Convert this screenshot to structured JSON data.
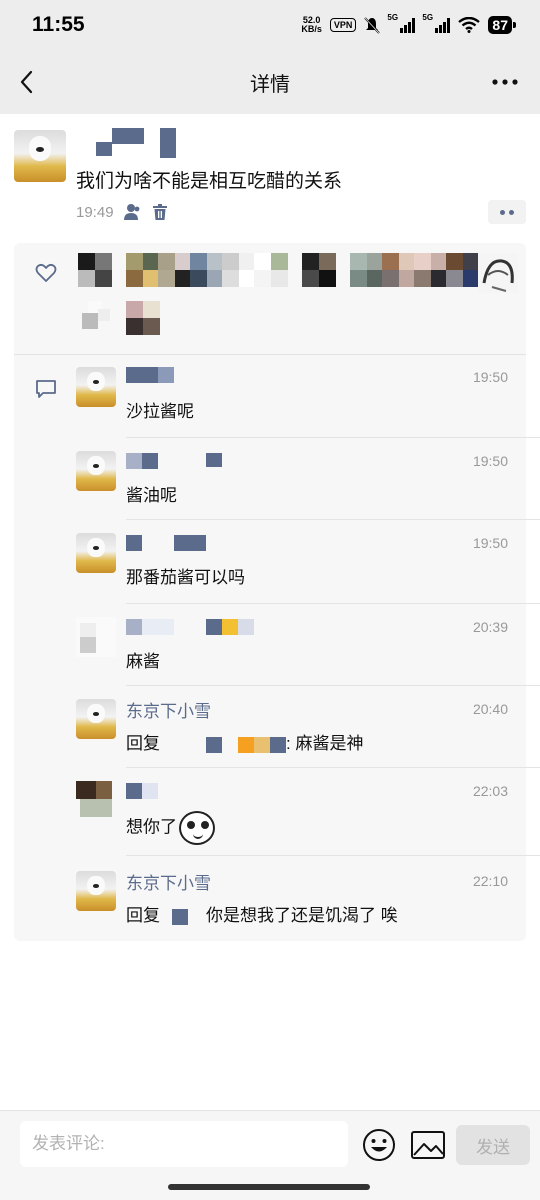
{
  "status_bar": {
    "time": "11:55",
    "net_speed_value": "52.0",
    "net_speed_unit": "KB/s",
    "vpn": "VPN",
    "sim1_label": "5G",
    "sim2_label": "5G",
    "battery": "87"
  },
  "nav": {
    "title": "详情",
    "back_icon": "chevron-left-icon",
    "more_icon": "more-horizontal-icon"
  },
  "post": {
    "text": "我们为啥不能是相互吃醋的关系",
    "time": "19:49",
    "visibility_icon": "person-icon",
    "delete_icon": "trash-icon"
  },
  "comments": [
    {
      "name": "",
      "time": "19:50",
      "text": "沙拉酱呢"
    },
    {
      "name": "",
      "time": "19:50",
      "text": "酱油呢"
    },
    {
      "name": "",
      "time": "19:50",
      "text": "那番茄酱可以吗"
    },
    {
      "name": "",
      "time": "20:39",
      "text": "麻酱"
    },
    {
      "name": "东京下小雪",
      "time": "20:40",
      "reply_prefix": "回复",
      "text": ": 麻酱是神"
    },
    {
      "name": "",
      "time": "22:03",
      "text": "想你了"
    },
    {
      "name": "东京下小雪",
      "time": "22:10",
      "reply_prefix": "回复",
      "text": "你是想我了还是饥渴了 唉"
    }
  ],
  "input": {
    "placeholder": "发表评论:",
    "value": ""
  },
  "actions": {
    "send_label": "发送",
    "emoji_icon": "smiley-icon",
    "image_icon": "image-icon"
  },
  "colors": {
    "nav_bg": "#ededed",
    "name_link": "#5b6b8c",
    "panel_bg": "#f7f7f7",
    "time_gray": "#999999"
  }
}
